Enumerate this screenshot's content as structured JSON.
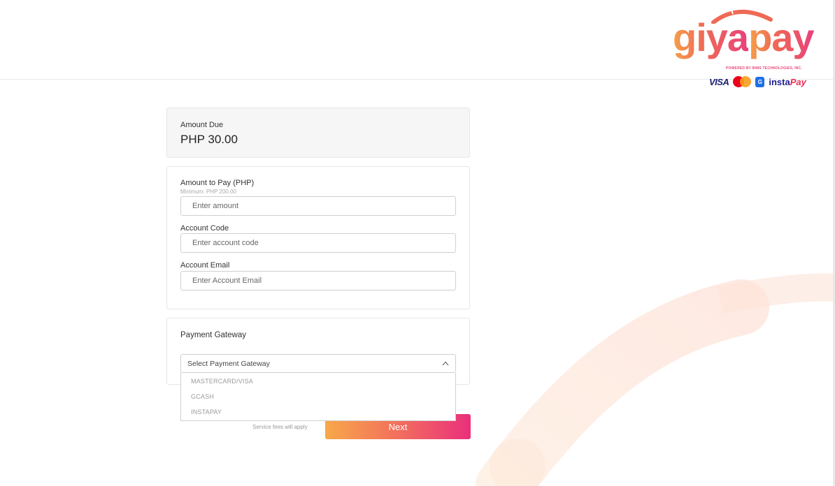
{
  "brand": {
    "name": "giyapay",
    "name_part1": "giya",
    "name_part2": "pay",
    "powered_by": "POWERED BY BIMS TECHNOLOGIES, INC.",
    "visa": "VISA",
    "gcash_mark": "G",
    "instapay_1": "insta",
    "instapay_2": "Pay",
    "colors": {
      "orange": "#f6a04a",
      "coral": "#ef6a55",
      "pink": "#e9417c"
    }
  },
  "amount_due": {
    "label": "Amount Due",
    "value": "PHP 30.00"
  },
  "form": {
    "amount_label": "Amount to Pay (PHP)",
    "amount_hint": "Minimum: PHP 200.00",
    "amount_placeholder": "Enter amount",
    "account_code_label": "Account Code",
    "account_code_placeholder": "Enter account code",
    "account_email_label": "Account Email",
    "account_email_placeholder": "Enter Account Email"
  },
  "gateway": {
    "title": "Payment Gateway",
    "select_placeholder": "Select Payment Gateway",
    "options": [
      "MASTERCARD/VISA",
      "GCASH",
      "INSTAPAY"
    ]
  },
  "footer": {
    "service_fees": "Service fees will apply",
    "next_label": "Next"
  },
  "icons": {
    "select_chevron": "chevron-up-icon",
    "mastercard": "mastercard-icon",
    "gcash": "gcash-icon"
  }
}
